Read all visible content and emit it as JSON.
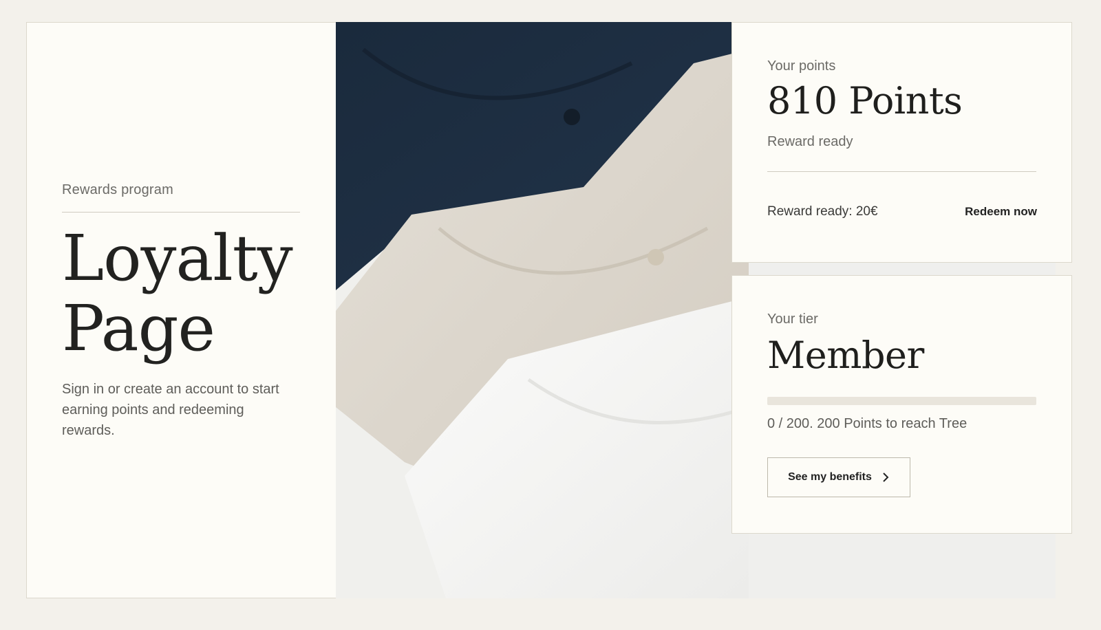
{
  "intro": {
    "eyebrow": "Rewards program",
    "title": "Loyalty Page",
    "description": "Sign in or create an account to start earning points and redeeming rewards."
  },
  "points_card": {
    "label": "Your points",
    "value": "810 Points",
    "status": "Reward ready",
    "reward_line": "Reward ready: 20€",
    "redeem_label": "Redeem now"
  },
  "tier_card": {
    "label": "Your tier",
    "tier": "Member",
    "progress_fraction": 0,
    "progress_text": "0 / 200. 200 Points to reach Tree",
    "benefits_label": "See my benefits"
  },
  "colors": {
    "page_bg": "#f3f1eb",
    "card_bg": "#fdfcf7",
    "navy_shirt": "#1d2d3f",
    "oatmeal_shirt": "#dcd6cc",
    "white_shirt": "#f6f6f4"
  },
  "icons": {
    "benefits_arrow": "chevron-right-icon"
  }
}
